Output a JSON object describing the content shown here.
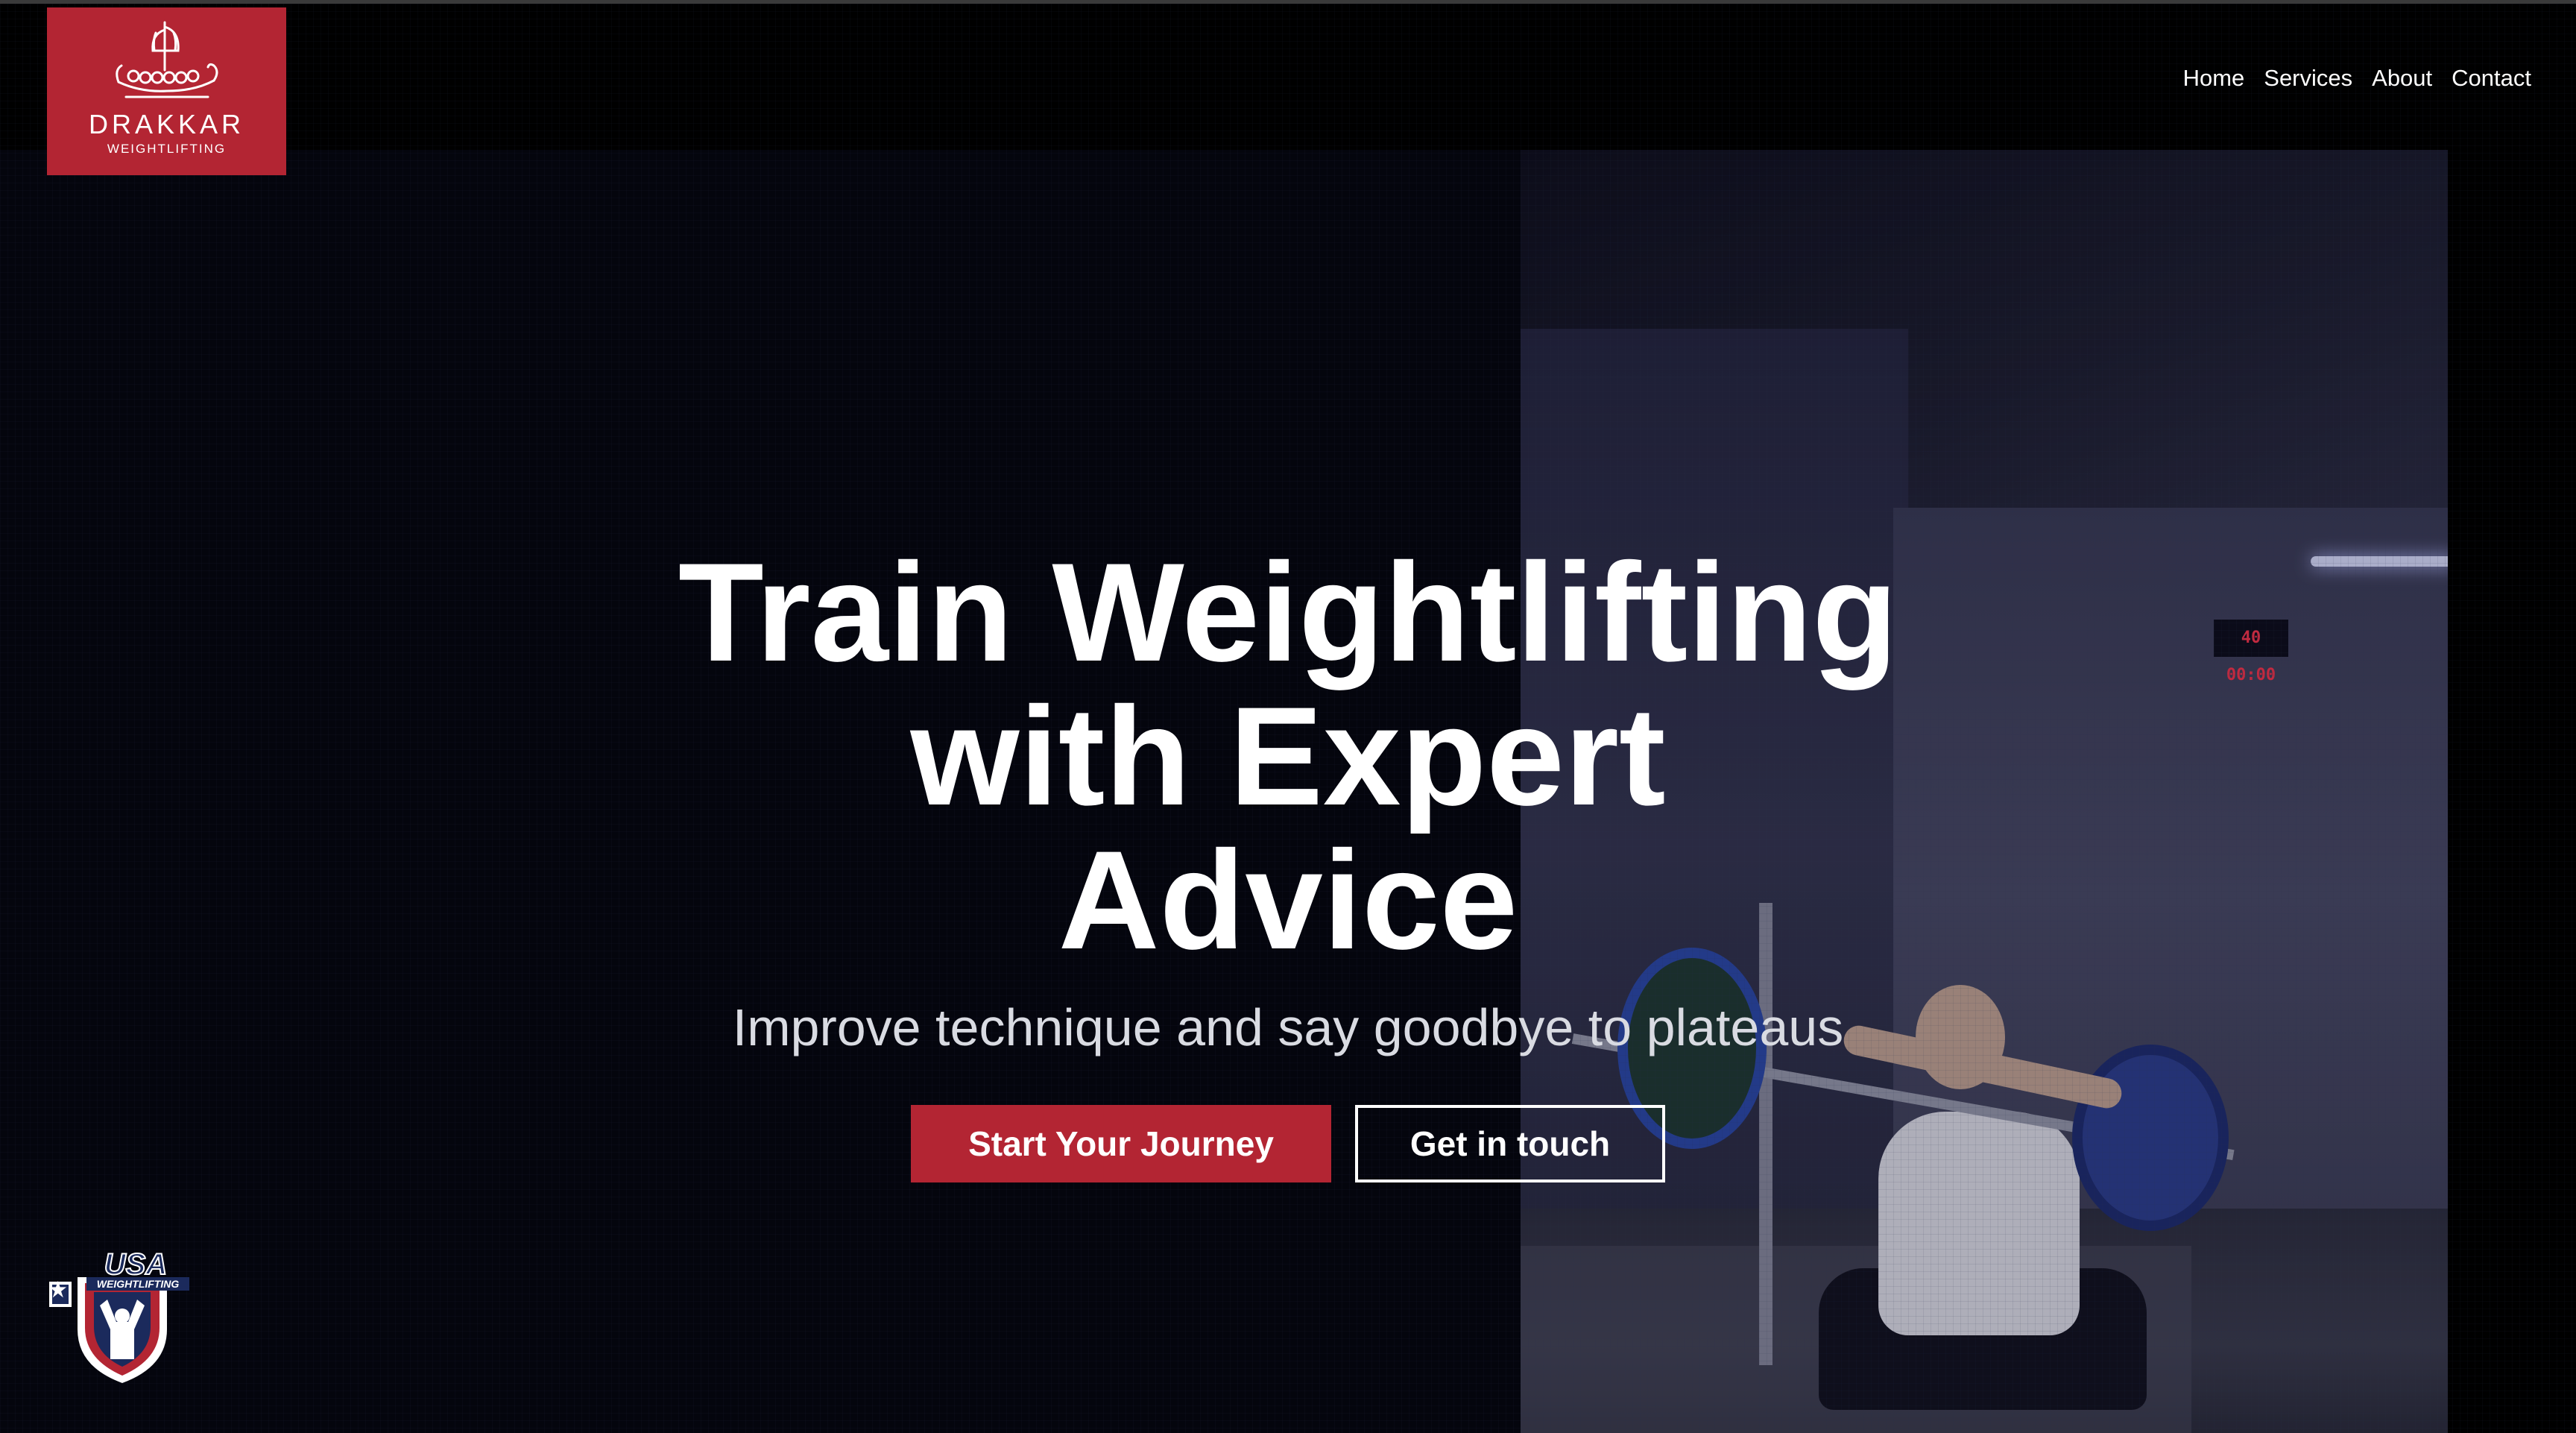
{
  "brand": {
    "name": "DRAKKAR",
    "subtitle": "WEIGHTLIFTING",
    "color": "#b32533"
  },
  "nav": {
    "items": [
      {
        "label": "Home"
      },
      {
        "label": "Services"
      },
      {
        "label": "About"
      },
      {
        "label": "Contact"
      }
    ]
  },
  "hero": {
    "title_lines": [
      "Train Weightlifting",
      "with Expert",
      "Advice"
    ],
    "subtitle": "Improve technique and say goodbye to plateaus",
    "primary_cta": "Start Your Journey",
    "secondary_cta": "Get in touch",
    "video_timer": "40 00:00"
  },
  "partner_badge": {
    "text_top": "USA",
    "text_bottom": "WEIGHTLIFTING",
    "icon": "usa-weightlifting-badge-icon"
  }
}
